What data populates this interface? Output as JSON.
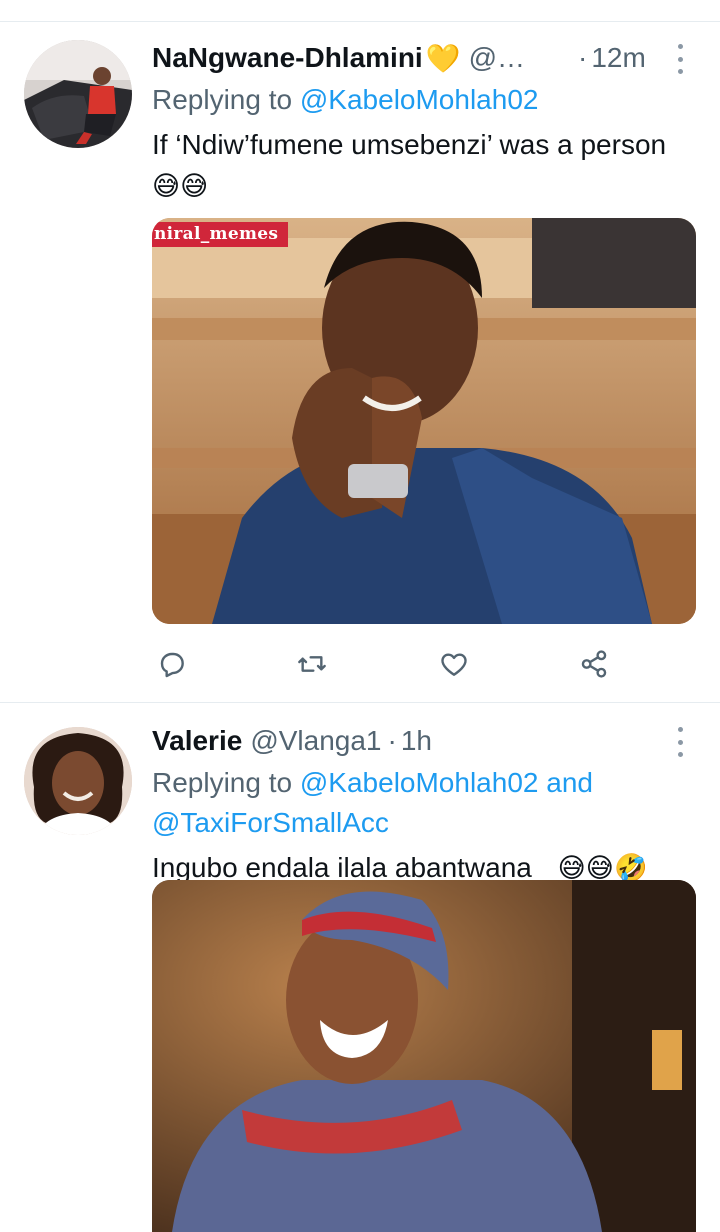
{
  "tweets": [
    {
      "author_name": "NaNgwane-Dhlamini",
      "name_emoji": "💛",
      "handle": "@n...",
      "dot": "·",
      "time": "12m",
      "replying_prefix": "Replying to",
      "replying_to": "@KabeloMohlah02",
      "text": "If ‘Ndiw’fumene umsebenzi’ was a person",
      "text_emojis": "😅😅",
      "image_watermark": "niral_memes",
      "actions": [
        "reply-icon",
        "retweet-icon",
        "like-icon",
        "share-icon"
      ]
    },
    {
      "author_name": "Valerie",
      "handle": "@Vlanga1",
      "dot": "·",
      "time": "1h",
      "replying_prefix": "Replying to",
      "replying_to_1": "@KabeloMohlah02",
      "replying_and": "and",
      "replying_to_2": "@TaxiForSmallAcc",
      "text": "Ingubo endala ilala abantwana",
      "text_emojis": "😅😅🤣"
    }
  ],
  "colors": {
    "link": "#1d9bf0",
    "secondary_text": "#536471",
    "primary_text": "#0f1419",
    "divider": "#e6ecf0",
    "watermark_bg": "#d0263a"
  }
}
